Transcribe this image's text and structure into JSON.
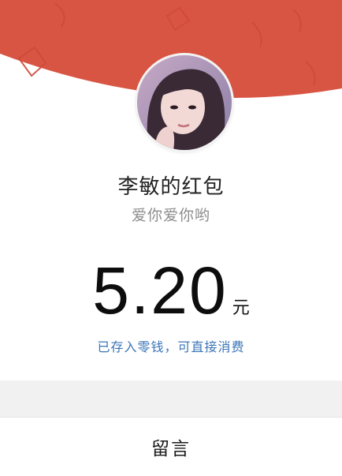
{
  "envelope": {
    "sender_title": "李敏的红包",
    "wish_text": "爱你爱你哟",
    "amount": "5.20",
    "amount_unit": "元",
    "saved_notice": "已存入零钱，可直接消费"
  },
  "footer": {
    "reply_label": "留言"
  },
  "colors": {
    "header_red": "#d95543",
    "link_blue": "#3b74b7",
    "gap_gray": "#f1f1f1"
  }
}
